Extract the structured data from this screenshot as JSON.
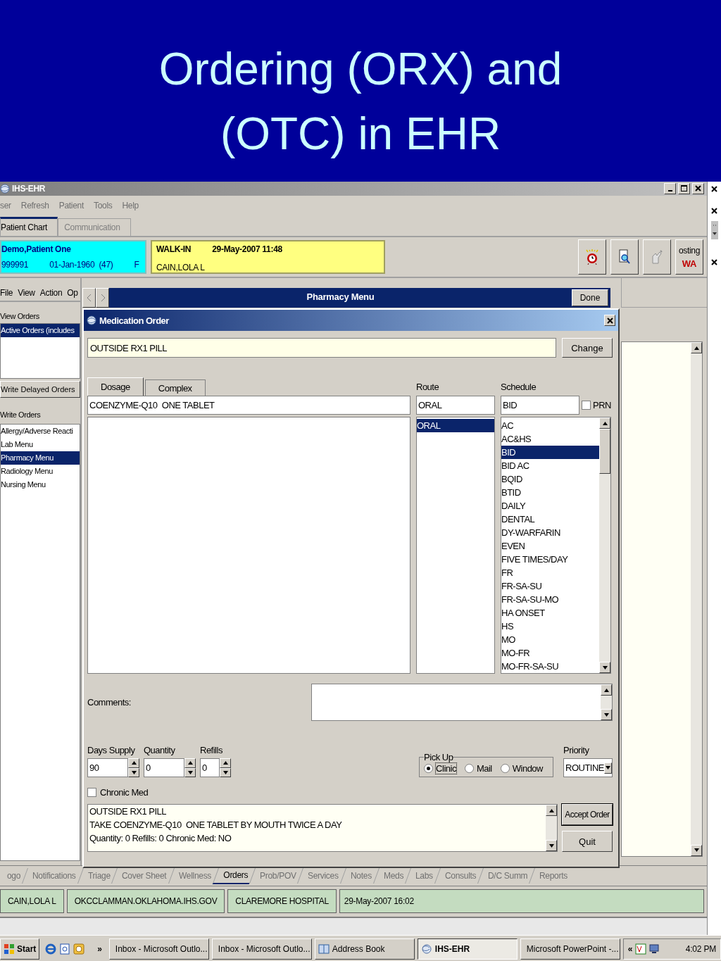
{
  "slide": {
    "title": "Ordering (ORX) and (OTC) in EHR"
  },
  "window": {
    "title": "IHS-EHR"
  },
  "menu": [
    "ser",
    "Refresh",
    "Patient",
    "Tools",
    "Help"
  ],
  "tabs": [
    {
      "label": "Patient Chart",
      "selected": true
    },
    {
      "label": "Communication",
      "selected": false
    }
  ],
  "patient": {
    "name": "Demo,Patient One",
    "id": "999991",
    "dob": "01-Jan-1960  (47)",
    "sex": "F"
  },
  "visit": {
    "type": "WALK-IN",
    "datetime": "29-May-2007 11:48",
    "provider": "CAIN,LOLA L"
  },
  "toolbar": {
    "posting_label": "osting",
    "posting_code": "WA"
  },
  "left_pane": {
    "menu": [
      "File",
      "View",
      "Action",
      "Op"
    ],
    "view_orders_label": "View Orders",
    "view_orders": [
      {
        "label": "Active Orders (includes",
        "selected": true
      }
    ],
    "delayed_button": "Write Delayed Orders",
    "write_orders_label": "Write Orders",
    "write_orders": [
      {
        "label": "Allergy/Adverse Reacti",
        "selected": false
      },
      {
        "label": "Lab Menu",
        "selected": false
      },
      {
        "label": "Pharmacy Menu",
        "selected": true
      },
      {
        "label": "Radiology Menu",
        "selected": false
      },
      {
        "label": "Nursing Menu",
        "selected": false
      }
    ]
  },
  "pharmacy_bar": {
    "title": "Pharmacy Menu",
    "done_button": "Done"
  },
  "dialog": {
    "title": "Medication Order",
    "drug": "OUTSIDE RX1 PILL",
    "change_button": "Change",
    "tabs": [
      {
        "label": "Dosage",
        "selected": true
      },
      {
        "label": "Complex",
        "selected": false
      }
    ],
    "dosage": "COENZYME-Q10  ONE TABLET",
    "route_label": "Route",
    "route": "ORAL",
    "routes": [
      {
        "label": "ORAL",
        "selected": true
      }
    ],
    "schedule_label": "Schedule",
    "schedule": "BID",
    "prn": {
      "label": "PRN",
      "checked": false
    },
    "schedules": [
      {
        "label": "AC",
        "selected": false
      },
      {
        "label": "AC&HS",
        "selected": false
      },
      {
        "label": "BID",
        "selected": true
      },
      {
        "label": "BID AC",
        "selected": false
      },
      {
        "label": "BQID",
        "selected": false
      },
      {
        "label": "BTID",
        "selected": false
      },
      {
        "label": "DAILY",
        "selected": false
      },
      {
        "label": "DENTAL",
        "selected": false
      },
      {
        "label": "DY-WARFARIN",
        "selected": false
      },
      {
        "label": "EVEN",
        "selected": false
      },
      {
        "label": "FIVE TIMES/DAY",
        "selected": false
      },
      {
        "label": "FR",
        "selected": false
      },
      {
        "label": "FR-SA-SU",
        "selected": false
      },
      {
        "label": "FR-SA-SU-MO",
        "selected": false
      },
      {
        "label": "HA ONSET",
        "selected": false
      },
      {
        "label": "HS",
        "selected": false
      },
      {
        "label": "MO",
        "selected": false
      },
      {
        "label": "MO-FR",
        "selected": false
      },
      {
        "label": "MO-FR-SA-SU",
        "selected": false
      }
    ],
    "comments_label": "Comments:",
    "days_supply": {
      "label": "Days Supply",
      "value": "90"
    },
    "quantity": {
      "label": "Quantity",
      "value": "0"
    },
    "refills": {
      "label": "Refills",
      "value": "0"
    },
    "pickup": {
      "label": "Pick Up",
      "options": [
        {
          "label": "Clinic",
          "selected": true
        },
        {
          "label": "Mail",
          "selected": false
        },
        {
          "label": "Window",
          "selected": false
        }
      ]
    },
    "priority": {
      "label": "Priority",
      "value": "ROUTINE"
    },
    "chronic_med": {
      "label": "Chronic Med",
      "checked": false
    },
    "summary": [
      "OUTSIDE RX1 PILL",
      "TAKE COENZYME-Q10  ONE TABLET BY MOUTH TWICE A DAY",
      "Quantity: 0 Refills: 0 Chronic Med: NO"
    ],
    "accept_button": "Accept Order",
    "quit_button": "Quit"
  },
  "bottom_tabs": [
    {
      "label": "ogo",
      "selected": false
    },
    {
      "label": "Notifications",
      "selected": false
    },
    {
      "label": "Triage",
      "selected": false
    },
    {
      "label": "Cover Sheet",
      "selected": false
    },
    {
      "label": "Wellness",
      "selected": false
    },
    {
      "label": "Orders",
      "selected": true
    },
    {
      "label": "Prob/POV",
      "selected": false
    },
    {
      "label": "Services",
      "selected": false
    },
    {
      "label": "Notes",
      "selected": false
    },
    {
      "label": "Meds",
      "selected": false
    },
    {
      "label": "Labs",
      "selected": false
    },
    {
      "label": "Consults",
      "selected": false
    },
    {
      "label": "D/C Summ",
      "selected": false
    },
    {
      "label": "Reports",
      "selected": false
    }
  ],
  "status_bar": [
    "CAIN,LOLA L",
    "OKCCLAMMAN.OKLAHOMA.IHS.GOV",
    "CLAREMORE HOSPITAL",
    "29-May-2007 16:02"
  ],
  "taskbar": {
    "start": "Start",
    "chevron": "»",
    "items": [
      {
        "label": "Inbox - Microsoft Outlo...",
        "kind": "outlook",
        "selected": false
      },
      {
        "label": "Inbox - Microsoft Outlo...",
        "kind": "outlook",
        "selected": false
      },
      {
        "label": "Address Book",
        "kind": "book",
        "selected": false
      },
      {
        "label": "IHS-EHR",
        "kind": "ehr",
        "selected": true
      },
      {
        "label": "Microsoft PowerPoint -...",
        "kind": "powerpoint",
        "selected": false
      }
    ],
    "tray_chevron": "«",
    "clock": "4:02 PM"
  }
}
